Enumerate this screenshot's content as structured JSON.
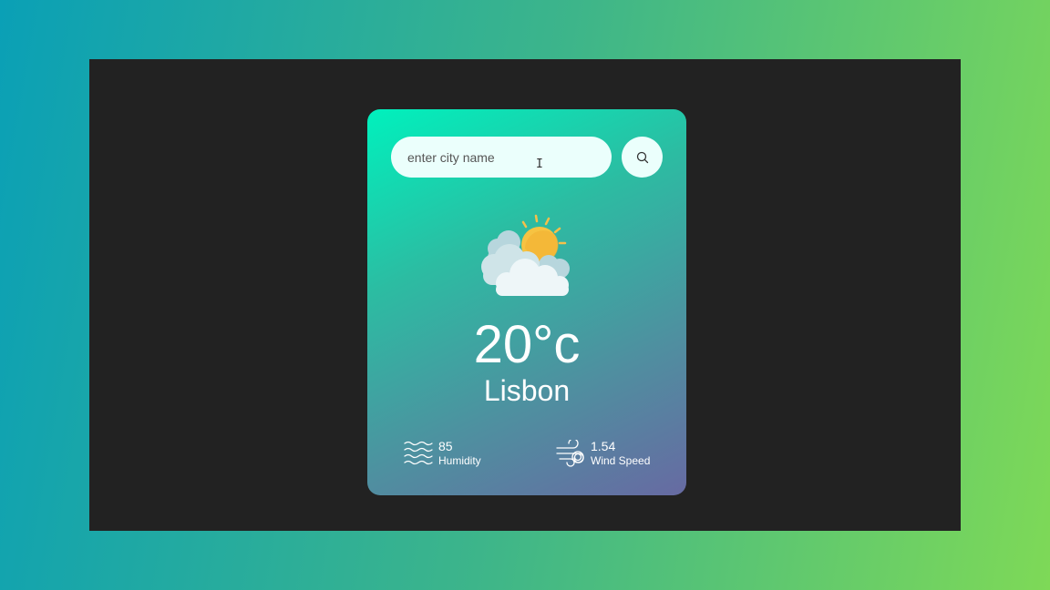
{
  "search": {
    "placeholder": "enter city name",
    "button_icon": "search-icon"
  },
  "weather": {
    "icon": "partly-cloudy-icon",
    "temperature": "20°c",
    "city": "Lisbon"
  },
  "details": {
    "humidity": {
      "icon": "humidity-waves-icon",
      "value": "85",
      "label": "Humidity"
    },
    "wind": {
      "icon": "wind-icon",
      "value": "1.54",
      "label": "Wind Speed"
    }
  },
  "colors": {
    "card_gradient_start": "#00f1bd",
    "card_gradient_end": "#676aa2",
    "stage_background": "#222222",
    "input_background": "#ebfffc"
  }
}
